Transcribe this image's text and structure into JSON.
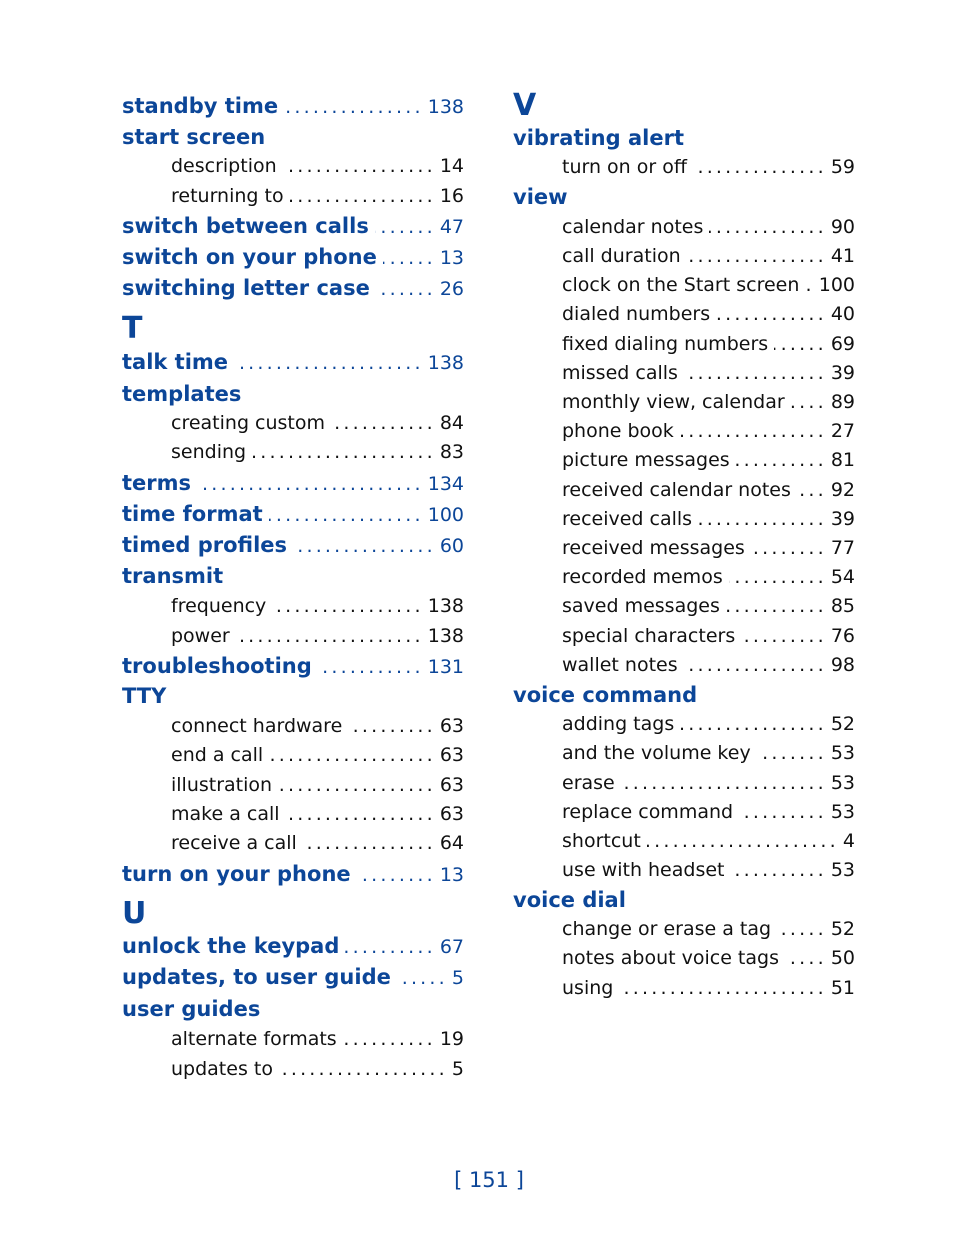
{
  "colors": {
    "heading": "#0c4698",
    "text": "#111111"
  },
  "left_column": [
    {
      "type": "head",
      "label": "standby time",
      "page": "138"
    },
    {
      "type": "head",
      "label": "start screen"
    },
    {
      "type": "sub",
      "label": "description",
      "page": "14"
    },
    {
      "type": "sub",
      "label": "returning to",
      "page": "16"
    },
    {
      "type": "head",
      "label": "switch between calls",
      "page": "47"
    },
    {
      "type": "head",
      "label": "switch on your phone",
      "page": "13"
    },
    {
      "type": "head",
      "label": "switching letter case",
      "page": "26"
    },
    {
      "type": "letter",
      "label": "T"
    },
    {
      "type": "head",
      "label": "talk time",
      "page": "138"
    },
    {
      "type": "head",
      "label": "templates"
    },
    {
      "type": "sub",
      "label": "creating custom",
      "page": "84"
    },
    {
      "type": "sub",
      "label": "sending",
      "page": "83"
    },
    {
      "type": "head",
      "label": "terms",
      "page": "134"
    },
    {
      "type": "head",
      "label": "time format",
      "page": "100"
    },
    {
      "type": "head",
      "label": "timed profiles",
      "page": "60"
    },
    {
      "type": "head",
      "label": "transmit"
    },
    {
      "type": "sub",
      "label": "frequency",
      "page": "138"
    },
    {
      "type": "sub",
      "label": "power",
      "page": "138"
    },
    {
      "type": "head",
      "label": "troubleshooting",
      "page": "131"
    },
    {
      "type": "head",
      "label": "TTY"
    },
    {
      "type": "sub",
      "label": "connect hardware",
      "page": "63"
    },
    {
      "type": "sub",
      "label": "end a call",
      "page": "63"
    },
    {
      "type": "sub",
      "label": "illustration",
      "page": "63"
    },
    {
      "type": "sub",
      "label": "make a call",
      "page": "63"
    },
    {
      "type": "sub",
      "label": "receive a call",
      "page": "64"
    },
    {
      "type": "head",
      "label": "turn on your phone",
      "page": "13"
    },
    {
      "type": "letter",
      "label": "U"
    },
    {
      "type": "head",
      "label": "unlock the keypad",
      "page": "67"
    },
    {
      "type": "head",
      "label": "updates, to user guide",
      "page": "5"
    },
    {
      "type": "head",
      "label": "user guides"
    },
    {
      "type": "sub",
      "label": "alternate formats",
      "page": "19"
    },
    {
      "type": "sub",
      "label": "updates to",
      "page": "5"
    }
  ],
  "right_column": [
    {
      "type": "letter",
      "label": "V"
    },
    {
      "type": "head",
      "label": "vibrating alert"
    },
    {
      "type": "sub",
      "label": "turn on or off",
      "page": "59"
    },
    {
      "type": "head",
      "label": "view"
    },
    {
      "type": "sub",
      "label": "calendar notes",
      "page": "90"
    },
    {
      "type": "sub",
      "label": "call duration",
      "page": "41"
    },
    {
      "type": "sub",
      "label": "clock on the Start screen",
      "page": "100"
    },
    {
      "type": "sub",
      "label": "dialed numbers",
      "page": "40"
    },
    {
      "type": "sub",
      "label": "fixed dialing numbers",
      "page": "69"
    },
    {
      "type": "sub",
      "label": "missed calls",
      "page": "39"
    },
    {
      "type": "sub",
      "label": "monthly view, calendar",
      "page": "89"
    },
    {
      "type": "sub",
      "label": "phone book",
      "page": "27"
    },
    {
      "type": "sub",
      "label": "picture messages",
      "page": "81"
    },
    {
      "type": "sub",
      "label": "received calendar notes",
      "page": "92"
    },
    {
      "type": "sub",
      "label": "received calls",
      "page": "39"
    },
    {
      "type": "sub",
      "label": "received messages",
      "page": "77"
    },
    {
      "type": "sub",
      "label": "recorded memos",
      "page": "54"
    },
    {
      "type": "sub",
      "label": "saved messages",
      "page": "85"
    },
    {
      "type": "sub",
      "label": "special characters",
      "page": "76"
    },
    {
      "type": "sub",
      "label": "wallet notes",
      "page": "98"
    },
    {
      "type": "head",
      "label": "voice command"
    },
    {
      "type": "sub",
      "label": "adding tags",
      "page": "52"
    },
    {
      "type": "sub",
      "label": "and the volume key",
      "page": "53"
    },
    {
      "type": "sub",
      "label": "erase",
      "page": "53"
    },
    {
      "type": "sub",
      "label": "replace command",
      "page": "53"
    },
    {
      "type": "sub",
      "label": "shortcut",
      "page": "4"
    },
    {
      "type": "sub",
      "label": "use with headset",
      "page": "53"
    },
    {
      "type": "head",
      "label": "voice dial"
    },
    {
      "type": "sub",
      "label": "change or erase a tag",
      "page": "52"
    },
    {
      "type": "sub",
      "label": "notes about voice tags",
      "page": "50"
    },
    {
      "type": "sub",
      "label": "using",
      "page": "51"
    }
  ],
  "footer": {
    "page_number": "[ 151 ]"
  }
}
